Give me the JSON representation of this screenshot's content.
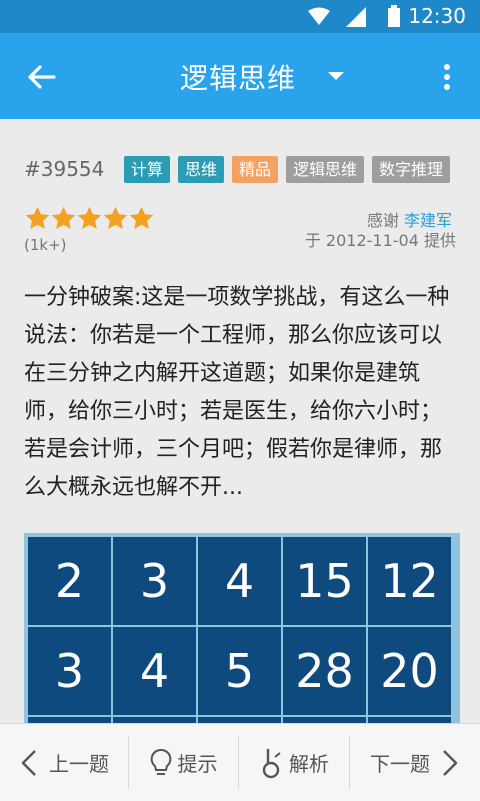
{
  "status_bar": {
    "time": "12:30"
  },
  "app_bar": {
    "title": "逻辑思维"
  },
  "question": {
    "id": "#39554",
    "tags": [
      {
        "label": "计算",
        "color": "#2a9db5"
      },
      {
        "label": "思维",
        "color": "#2a9db5"
      },
      {
        "label": "精品",
        "color": "#f4a261"
      },
      {
        "label": "逻辑思维",
        "color": "#9e9e9e"
      },
      {
        "label": "数字推理",
        "color": "#9e9e9e"
      }
    ],
    "rating": {
      "stars": 5,
      "count_label": "(1k+)"
    },
    "credit": {
      "thanks_label": "感谢",
      "contributor": "李建军",
      "provided": "于 2012-11-04 提供"
    },
    "text": "一分钟破案:这是一项数学挑战，有这么一种说法：你若是一个工程师，那么你应该可以在三分钟之内解开这道题；如果你是建筑师，给你三小时；若是医生，给你六小时；若是会计师，三个月吧；假若你是律师，那么大概永远也解不开...",
    "grid": [
      [
        "2",
        "3",
        "4",
        "15",
        "12"
      ],
      [
        "3",
        "4",
        "5",
        "28",
        "20"
      ],
      [
        "",
        "",
        "",
        "",
        ""
      ]
    ]
  },
  "bottom_bar": {
    "prev": "上一题",
    "hint": "提示",
    "analysis": "解析",
    "next": "下一题"
  },
  "colors": {
    "status_bar": "#1e88c8",
    "app_bar": "#29a3ec",
    "grid_cell": "#0e4a7e",
    "star": "#f4a021"
  }
}
